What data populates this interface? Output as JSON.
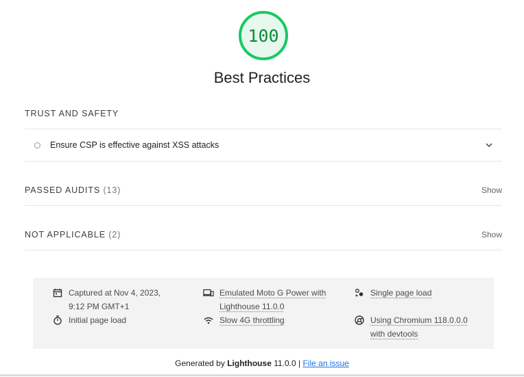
{
  "category": {
    "score": "100",
    "title": "Best Practices"
  },
  "groups": {
    "trust": {
      "title": "TRUST AND SAFETY"
    },
    "passed": {
      "title": "PASSED AUDITS",
      "count": "(13)",
      "toggle": "Show"
    },
    "not_applicable": {
      "title": "NOT APPLICABLE",
      "count": "(2)",
      "toggle": "Show"
    }
  },
  "audits": [
    {
      "title": "Ensure CSP is effective against XSS attacks"
    }
  ],
  "meta": {
    "captured": "Captured at Nov 4, 2023, 9:12 PM GMT+1",
    "initial_load": "Initial page load",
    "device": "Emulated Moto G Power with Lighthouse 11.0.0",
    "throttling": "Slow 4G throttling",
    "single_load": "Single page load",
    "browser": "Using Chromium 118.0.0.0 with devtools"
  },
  "footer": {
    "generated_prefix": "Generated by ",
    "lighthouse": "Lighthouse",
    "version": " 11.0.0 | ",
    "file_issue": "File an issue"
  },
  "colors": {
    "pass": "#0b8a3a",
    "ring": "#18c964"
  }
}
